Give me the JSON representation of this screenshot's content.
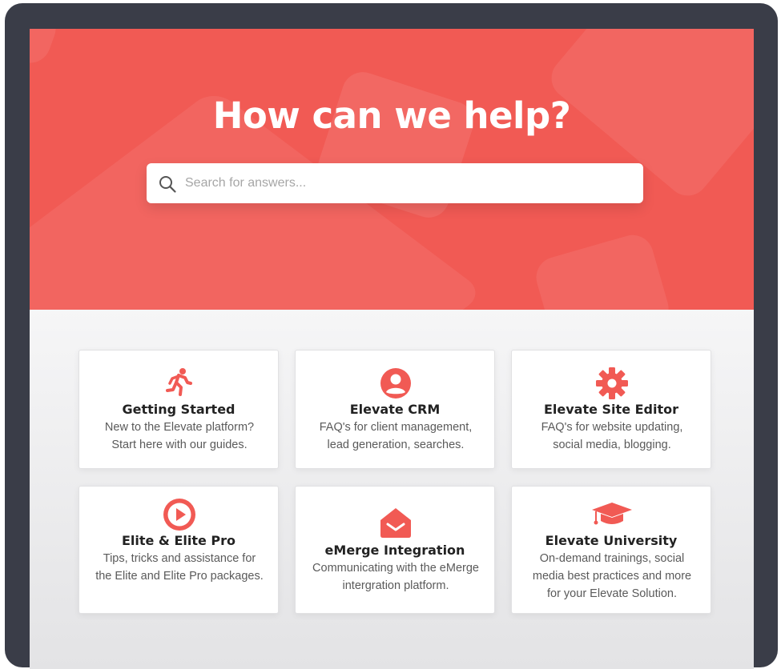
{
  "hero": {
    "title": "How can we help?",
    "search_placeholder": "Search for answers...",
    "accent_color": "#f15a54"
  },
  "cards": [
    {
      "icon": "running-person-icon",
      "title": "Getting Started",
      "description": "New to the Elevate platform? Start here with our guides."
    },
    {
      "icon": "user-circle-icon",
      "title": "Elevate CRM",
      "description": "FAQ's for client management, lead generation, searches."
    },
    {
      "icon": "gear-icon",
      "title": "Elevate Site Editor",
      "description": "FAQ's for website updating, social media, blogging."
    },
    {
      "icon": "play-circle-icon",
      "title": "Elite & Elite Pro",
      "description": "Tips, tricks and assistance for the Elite and Elite Pro packages."
    },
    {
      "icon": "open-envelope-icon",
      "title": "eMerge Integration",
      "description": "Communicating with the eMerge intergration platform."
    },
    {
      "icon": "graduation-cap-icon",
      "title": "Elevate University",
      "description": "On-demand trainings, social media best practices and more for your Elevate Solution."
    }
  ]
}
